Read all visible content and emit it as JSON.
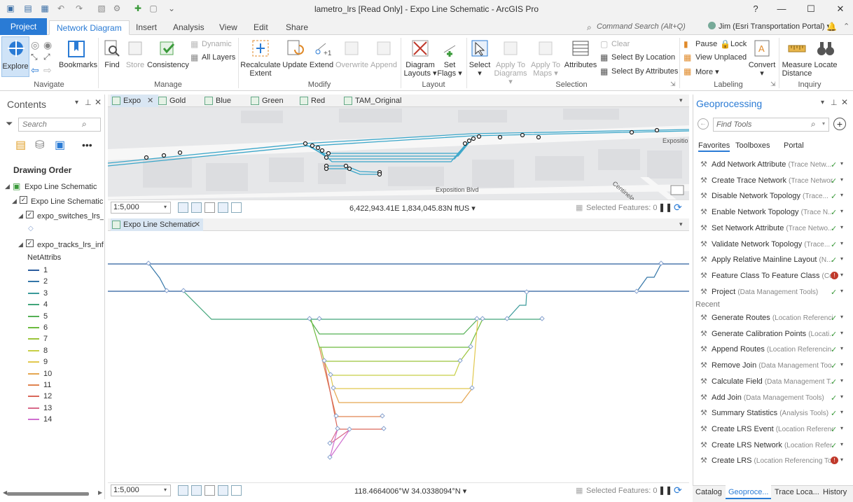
{
  "window": {
    "title": "lametro_lrs [Read Only] - Expo Line Schematic - ArcGIS Pro",
    "help": "?",
    "minimize": "—",
    "maximize": "☐",
    "close": "✕"
  },
  "tabs": [
    "Project",
    "Network Diagram",
    "Insert",
    "Analysis",
    "View",
    "Edit",
    "Share"
  ],
  "command_search": "Command Search (Alt+Q)",
  "user": "Jim (Esri Transportation Portal) ▾",
  "ribbon": {
    "navigate": {
      "explore": "Explore",
      "bookmarks": "Bookmarks",
      "label": "Navigate"
    },
    "manage": {
      "find": "Find",
      "store": "Store",
      "consistency": "Consistency",
      "dynamic": "Dynamic",
      "all_layers": "All Layers",
      "label": "Manage"
    },
    "modify": {
      "recalc": "Recalculate",
      "recalc2": "Extent",
      "update": "Update",
      "extend": "Extend",
      "overwrite": "Overwrite",
      "append": "Append",
      "label": "Modify"
    },
    "layout": {
      "diagram_layouts": "Diagram",
      "diagram_layouts2": "Layouts ▾",
      "set_flags": "Set",
      "set_flags2": "Flags ▾",
      "label": "Layout"
    },
    "selection": {
      "select": "Select",
      "apply_diagrams": "Apply To",
      "apply_diagrams2": "Diagrams ▾",
      "apply_maps": "Apply To",
      "apply_maps2": "Maps ▾",
      "attributes": "Attributes",
      "clear": "Clear",
      "by_location": "Select By Location",
      "by_attributes": "Select By Attributes",
      "label": "Selection"
    },
    "labeling": {
      "pause": "Pause",
      "lock": "Lock",
      "view_unplaced": "View Unplaced",
      "more": "More ▾",
      "convert": "Convert",
      "label": "Labeling"
    },
    "inquiry": {
      "measure": "Measure",
      "measure2": "Distance",
      "locate": "Locate",
      "label": "Inquiry"
    }
  },
  "contents": {
    "title": "Contents",
    "search_placeholder": "Search",
    "drawing_order": "Drawing Order",
    "items": [
      "Expo Line Schematic",
      "Expo Line Schematic",
      "expo_switches_lrs_inf",
      "expo_tracks_lrs_infds"
    ],
    "netattribs_label": "NetAttribs",
    "legend": [
      {
        "label": "1",
        "color": "#2b5d9e"
      },
      {
        "label": "2",
        "color": "#3476a8"
      },
      {
        "label": "3",
        "color": "#3a9a9a"
      },
      {
        "label": "4",
        "color": "#41a57a"
      },
      {
        "label": "5",
        "color": "#55b055"
      },
      {
        "label": "6",
        "color": "#6cbb3e"
      },
      {
        "label": "7",
        "color": "#9bc43a"
      },
      {
        "label": "8",
        "color": "#c8cf46"
      },
      {
        "label": "9",
        "color": "#e1c84e"
      },
      {
        "label": "10",
        "color": "#e5a650"
      },
      {
        "label": "11",
        "color": "#e08450"
      },
      {
        "label": "12",
        "color": "#d9675a"
      },
      {
        "label": "13",
        "color": "#d86a8a"
      },
      {
        "label": "14",
        "color": "#cf6fd0"
      }
    ]
  },
  "map_tabs": [
    "Expo",
    "Gold",
    "Blue",
    "Green",
    "Red",
    "TAM_Original"
  ],
  "top_map": {
    "street_labels": [
      "Exposition Blvd",
      "Expositio",
      "Centinela"
    ],
    "scale": "1:5,000",
    "coords": "6,422,943.41E 1,834,045.83N ftUS ▾",
    "selected": "Selected Features: 0"
  },
  "diagram_tab": "Expo Line Schematic",
  "bottom_map": {
    "scale": "1:5,000",
    "coords": "118.4664006°W 34.0338094°N ▾",
    "selected": "Selected Features: 0"
  },
  "geoprocessing": {
    "title": "Geoprocessing",
    "find_placeholder": "Find Tools",
    "subtabs": [
      "Favorites",
      "Toolboxes",
      "Portal"
    ],
    "favorites": [
      {
        "name": "Add Network Attribute",
        "sub": "(Trace Netw...",
        "status": "ok"
      },
      {
        "name": "Create Trace Network",
        "sub": "(Trace Networ...",
        "status": "ok"
      },
      {
        "name": "Disable Network Topology",
        "sub": "(Trace...",
        "status": "ok"
      },
      {
        "name": "Enable Network Topology",
        "sub": "(Trace N...",
        "status": "ok"
      },
      {
        "name": "Set Network Attribute",
        "sub": "(Trace Netwo...",
        "status": "ok"
      },
      {
        "name": "Validate Network Topology",
        "sub": "(Trace...",
        "status": "ok"
      },
      {
        "name": "Apply Relative Mainline Layout",
        "sub": "(N...",
        "status": "ok"
      },
      {
        "name": "Feature Class To Feature Class",
        "sub": "(Co...",
        "status": "warn"
      },
      {
        "name": "Project",
        "sub": "(Data Management Tools)",
        "status": "ok"
      }
    ],
    "recent_label": "Recent",
    "recent": [
      {
        "name": "Generate Routes",
        "sub": "(Location Referenci...",
        "status": "ok"
      },
      {
        "name": "Generate Calibration Points",
        "sub": "(Locati...",
        "status": "ok"
      },
      {
        "name": "Append Routes",
        "sub": "(Location Referencin...",
        "status": "ok"
      },
      {
        "name": "Remove Join",
        "sub": "(Data Management Too...",
        "status": "ok"
      },
      {
        "name": "Calculate Field",
        "sub": "(Data Management T...",
        "status": "ok"
      },
      {
        "name": "Add Join",
        "sub": "(Data Management Tools)",
        "status": "ok"
      },
      {
        "name": "Summary Statistics",
        "sub": "(Analysis Tools)",
        "status": "ok"
      },
      {
        "name": "Create LRS Event",
        "sub": "(Location Referenci...",
        "status": "ok"
      },
      {
        "name": "Create LRS Network",
        "sub": "(Location Refer...",
        "status": "ok"
      },
      {
        "name": "Create LRS",
        "sub": "(Location Referencing Too...",
        "status": "warn"
      }
    ],
    "bottom_tabs": [
      "Catalog",
      "Geoproce...",
      "Trace Loca...",
      "History"
    ]
  }
}
